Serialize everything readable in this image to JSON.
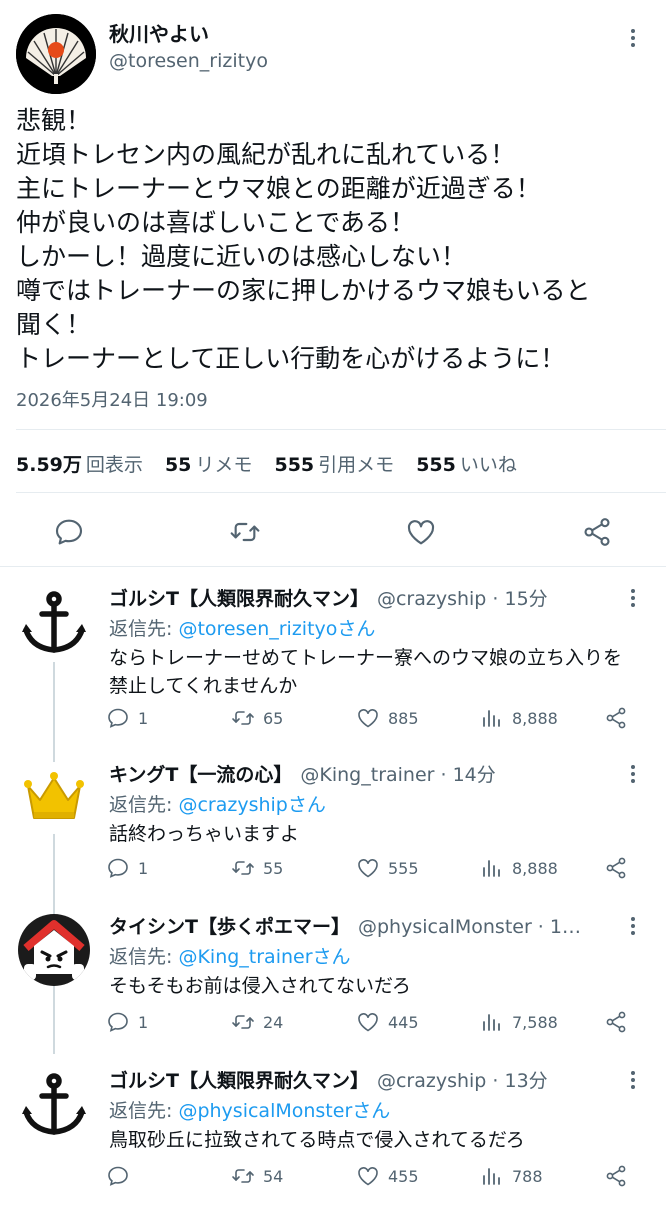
{
  "main_tweet": {
    "display_name": "秋川やよい",
    "handle": "@toresen_rizityo",
    "body_lines": [
      "悲観！",
      "近頃トレセン内の風紀が乱れに乱れている！",
      "主にトレーナーとウマ娘との距離が近過ぎる！",
      "仲が良いのは喜ばしいことである！",
      "しかーし！過度に近いのは感心しない！",
      "噂ではトレーナーの家に押しかけるウマ娘もいると",
      "聞く！",
      "トレーナーとして正しい行動を心がけるように！"
    ],
    "timestamp": "2026年5月24日 19:09",
    "stats": {
      "views_value": "5.59万",
      "views_label": "回表示",
      "retweets_value": "55",
      "retweets_label": "リメモ",
      "quotes_value": "555",
      "quotes_label": "引用メモ",
      "likes_value": "555",
      "likes_label": "いいね"
    },
    "icons": [
      "reply-icon",
      "retweet-icon",
      "like-icon",
      "share-icon"
    ]
  },
  "replies": [
    {
      "display_name": "ゴルシT【人類限界耐久マン】",
      "handle": "@crazyship · 15分",
      "reply_to_prefix": "返信先: ",
      "reply_to": "@toresen_rizityoさん",
      "text": "ならトレーナーせめてトレーナー寮へのウマ娘の立ち入りを禁止してくれませんか",
      "reply_count": "1",
      "retweet_count": "65",
      "like_count": "885",
      "view_count": "8,888",
      "avatar_icon": "anchor-icon"
    },
    {
      "display_name": "キングT【一流の心】",
      "handle": "@King_trainer · 14分",
      "reply_to_prefix": "返信先: ",
      "reply_to": "@crazyshipさん",
      "text": "話終わっちゃいますよ",
      "reply_count": "1",
      "retweet_count": "55",
      "like_count": "555",
      "view_count": "8,888",
      "avatar_icon": "crown-icon"
    },
    {
      "display_name": "タイシンT【歩くポエマー】",
      "handle": "@physicalMonster · 1…",
      "reply_to_prefix": "返信先: ",
      "reply_to": "@King_trainerさん",
      "text": "そもそもお前は侵入されてないだろ",
      "reply_count": "1",
      "retweet_count": "24",
      "like_count": "445",
      "view_count": "7,588",
      "avatar_icon": "house-face-icon"
    },
    {
      "display_name": "ゴルシT【人類限界耐久マン】",
      "handle": "@crazyship · 13分",
      "reply_to_prefix": "返信先: ",
      "reply_to": "@physicalMonsterさん",
      "text": "鳥取砂丘に拉致されてる時点で侵入されてるだろ",
      "reply_count": "",
      "retweet_count": "54",
      "like_count": "455",
      "view_count": "788",
      "avatar_icon": "anchor-icon"
    }
  ]
}
